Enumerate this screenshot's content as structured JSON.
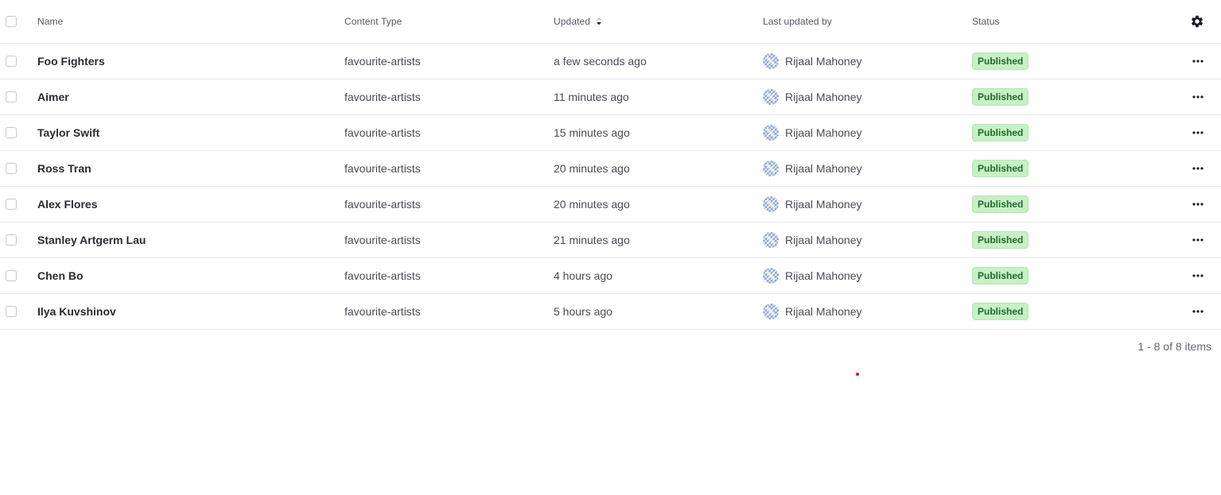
{
  "header": {
    "name": "Name",
    "content_type": "Content Type",
    "updated": "Updated",
    "last_updated_by": "Last updated by",
    "status": "Status"
  },
  "rows": [
    {
      "name": "Foo Fighters",
      "content_type": "favourite-artists",
      "updated": "a few seconds ago",
      "author": "Rijaal Mahoney",
      "status": "Published"
    },
    {
      "name": "Aimer",
      "content_type": "favourite-artists",
      "updated": "11 minutes ago",
      "author": "Rijaal Mahoney",
      "status": "Published"
    },
    {
      "name": "Taylor Swift",
      "content_type": "favourite-artists",
      "updated": "15 minutes ago",
      "author": "Rijaal Mahoney",
      "status": "Published"
    },
    {
      "name": "Ross Tran",
      "content_type": "favourite-artists",
      "updated": "20 minutes ago",
      "author": "Rijaal Mahoney",
      "status": "Published"
    },
    {
      "name": "Alex Flores",
      "content_type": "favourite-artists",
      "updated": "20 minutes ago",
      "author": "Rijaal Mahoney",
      "status": "Published"
    },
    {
      "name": "Stanley Artgerm Lau",
      "content_type": "favourite-artists",
      "updated": "21 minutes ago",
      "author": "Rijaal Mahoney",
      "status": "Published"
    },
    {
      "name": "Chen Bo",
      "content_type": "favourite-artists",
      "updated": "4 hours ago",
      "author": "Rijaal Mahoney",
      "status": "Published"
    },
    {
      "name": "Ilya Kuvshinov",
      "content_type": "favourite-artists",
      "updated": "5 hours ago",
      "author": "Rijaal Mahoney",
      "status": "Published"
    }
  ],
  "pagination": {
    "summary": "1 - 8 of 8 items"
  },
  "icons": {
    "sort": "sort-descending-icon",
    "settings": "gear-icon",
    "row_actions": "ellipsis-icon",
    "avatar": "user-avatar-icon"
  },
  "colors": {
    "status_badge_bg": "#c8f0c6",
    "status_badge_text": "#1f6b2a",
    "row_divider": "#e8e8ee"
  }
}
